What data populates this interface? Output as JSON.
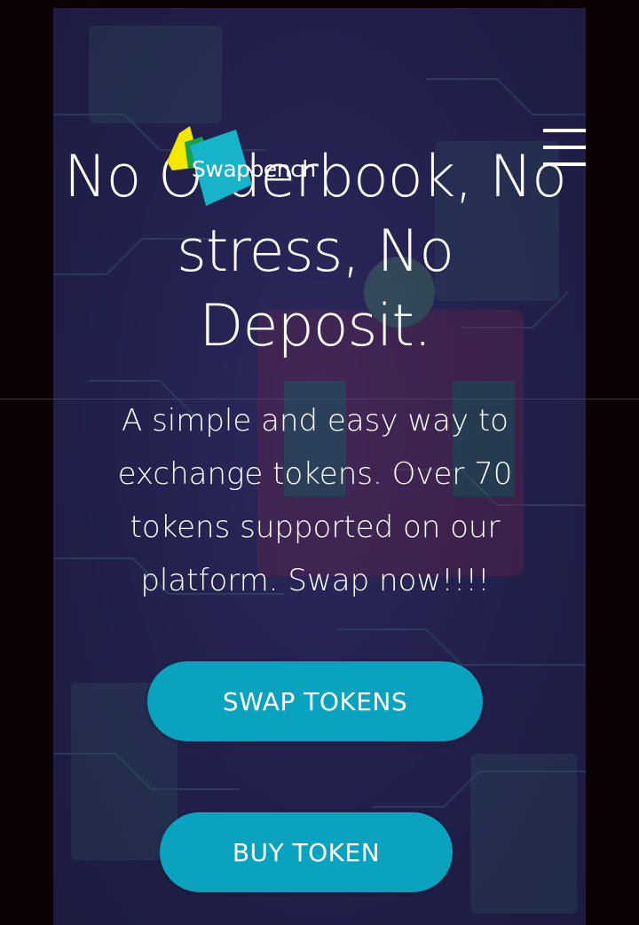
{
  "colors": {
    "page_background": "#0a0204",
    "panel_background": "#24224f",
    "button_background": "#0aa3bf",
    "text": "#ffffff",
    "logo_yellow": "#f3e600",
    "logo_green": "#19a14a",
    "logo_teal": "#17b4c9"
  },
  "brand": {
    "logo_text": "Swapbench"
  },
  "header": {
    "menu_icon": "hamburger-menu-icon"
  },
  "hero": {
    "headline": "No Orderbook, No stress, No Deposit.",
    "subtext": "A simple and easy way to exchange tokens. Over 70 tokens supported on our platform. Swap now!!!!"
  },
  "actions": {
    "swap_label": "SWAP TOKENS",
    "buy_label": "BUY TOKEN"
  }
}
